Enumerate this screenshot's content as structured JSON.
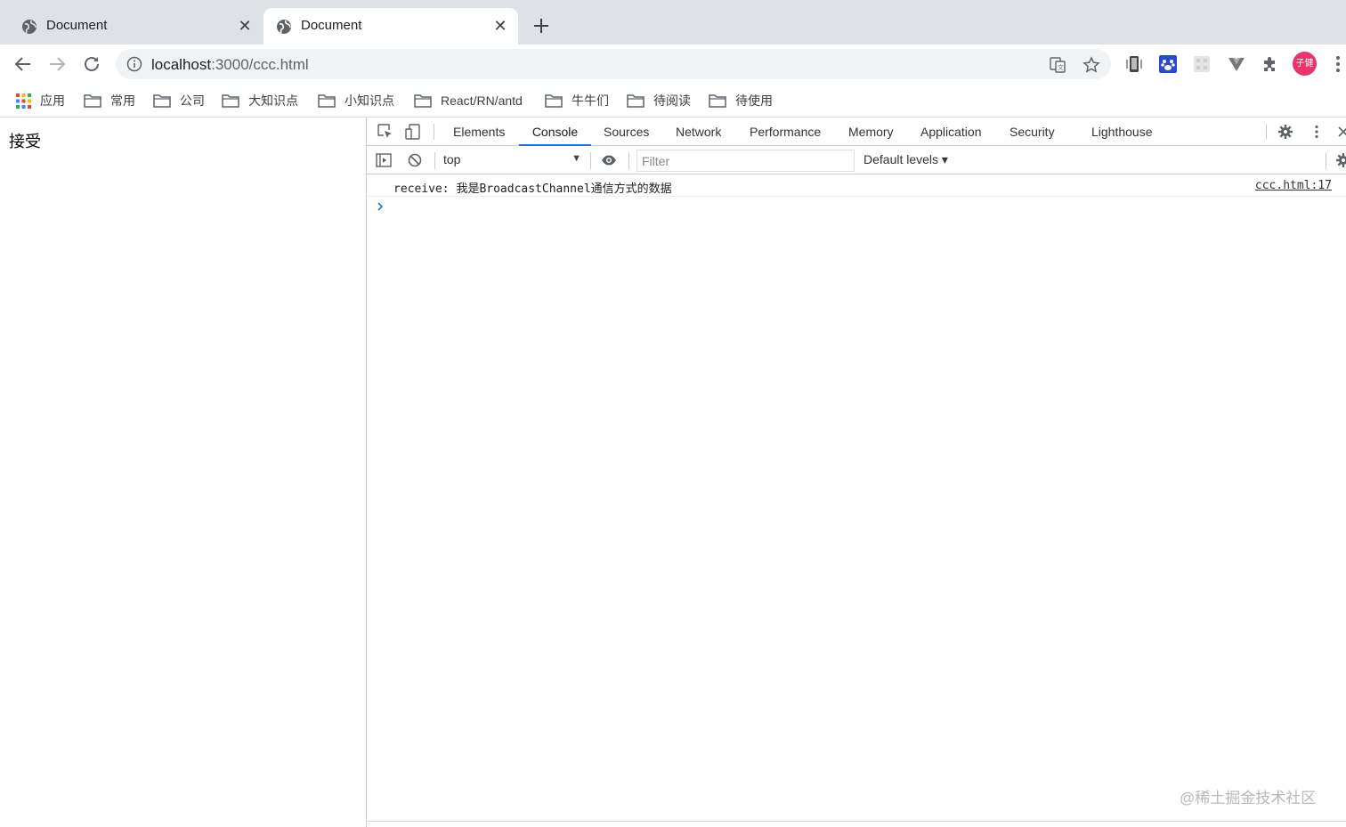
{
  "tabs": [
    {
      "title": "Document",
      "close": "✕"
    },
    {
      "title": "Document",
      "close": "✕"
    }
  ],
  "toolbar": {
    "url_host": "localhost",
    "url_rest": ":3000/ccc.html",
    "avatar_text": "子健"
  },
  "bookmarks": [
    {
      "label": "应用",
      "icon": "apps-grid-icon"
    },
    {
      "label": "常用",
      "icon": "folder-icon"
    },
    {
      "label": "公司",
      "icon": "folder-icon"
    },
    {
      "label": "大知识点",
      "icon": "folder-icon"
    },
    {
      "label": "小知识点",
      "icon": "folder-icon"
    },
    {
      "label": "React/RN/antd",
      "icon": "folder-icon"
    },
    {
      "label": "牛牛们",
      "icon": "folder-icon"
    },
    {
      "label": "待阅读",
      "icon": "folder-icon"
    },
    {
      "label": "待使用",
      "icon": "folder-icon"
    }
  ],
  "page": {
    "text": "接受"
  },
  "devtools": {
    "tabs": [
      "Elements",
      "Console",
      "Sources",
      "Network",
      "Performance",
      "Memory",
      "Application",
      "Security",
      "Lighthouse"
    ],
    "active_tab": "Console",
    "context": "top",
    "filter_placeholder": "Filter",
    "levels": "Default levels ▾",
    "messages": [
      {
        "text": "receive: 我是BroadcastChannel通信方式的数据",
        "source": "ccc.html:17"
      }
    ]
  },
  "watermark": "@稀土掘金技术社区",
  "colors": {
    "accent": "#1a73e8",
    "avatar": "#e8336b",
    "tabstrip": "#dee1e6"
  }
}
